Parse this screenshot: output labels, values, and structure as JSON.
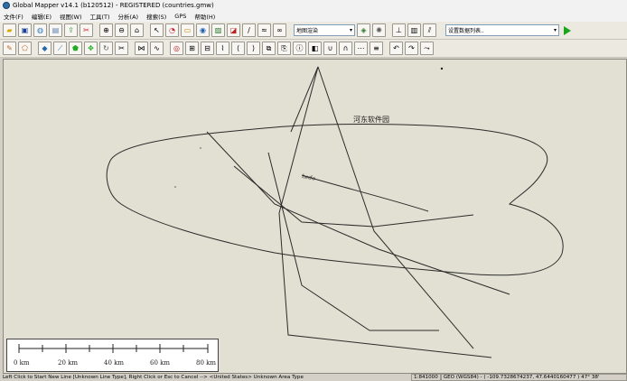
{
  "window": {
    "title": "Global Mapper v14.1 (b120512) - REGISTERED (countries.gmw)"
  },
  "menu": {
    "items": [
      "文件(F)",
      "编辑(E)",
      "视图(W)",
      "工具(T)",
      "分析(A)",
      "搜索(S)",
      "GPS",
      "帮助(H)"
    ]
  },
  "toolbar": {
    "shader_select": "地图渲染",
    "config_select": "设置数据列表..",
    "row1_icons": [
      "open-icon",
      "save-icon",
      "globe-icon",
      "layers-icon",
      "export-icon",
      "tools-icon",
      "zoom-in-icon",
      "zoom-out-icon",
      "home-icon",
      "select-icon",
      "measure-icon",
      "digitize-icon",
      "pick-icon",
      "view3d-icon",
      "profile-icon",
      "line-icon",
      "contour-icon",
      "binoculars-icon"
    ],
    "row2_icons": [
      "edit-line-icon",
      "edit-area-icon",
      "create-point-icon",
      "create-line-icon",
      "create-area-icon",
      "move-icon",
      "rotate-icon",
      "split-icon",
      "join-icon",
      "smooth-icon",
      "buffer-icon",
      "vertex-add-icon",
      "vertex-del-icon",
      "reshape-icon",
      "cut-icon",
      "merge-icon",
      "copy-icon",
      "paste-icon",
      "feature-info-icon",
      "clip-icon",
      "union-icon",
      "intersect-icon",
      "simplify-icon",
      "attribute-icon",
      "undo-icon",
      "redo-icon",
      "snap-icon"
    ]
  },
  "map": {
    "labels": {
      "area_name": "河东软件园",
      "line_name": "hedo"
    },
    "scale_labels": [
      "0 km",
      "20 km",
      "40 km",
      "60 km",
      "80 km"
    ]
  },
  "status": {
    "message": "Left Click to Start New Line [Unknown Line Type], Right Click or Esc to Cancel --> <United States> Unknown Area Type",
    "scale": "1:841000",
    "coords": "GEO (WGS84) - ( -109.7328674237, 47.6440160477 )  47° 38'"
  }
}
